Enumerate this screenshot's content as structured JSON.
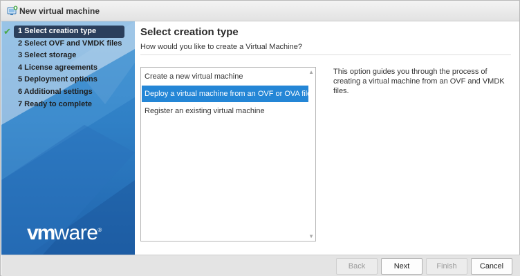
{
  "window": {
    "title": "New virtual machine",
    "icon": "new-vm-icon"
  },
  "sidebar": {
    "steps": [
      {
        "label": "1 Select creation type",
        "active": true,
        "completed": true
      },
      {
        "label": "2 Select OVF and VMDK files"
      },
      {
        "label": "3 Select storage"
      },
      {
        "label": "4 License agreements"
      },
      {
        "label": "5 Deployment options"
      },
      {
        "label": "6 Additional settings"
      },
      {
        "label": "7 Ready to complete"
      }
    ],
    "check_glyph": "✔",
    "logo": {
      "vm": "vm",
      "ware": "ware",
      "reg": "®"
    }
  },
  "main": {
    "title": "Select creation type",
    "subtitle": "How would you like to create a Virtual Machine?",
    "options": [
      {
        "label": "Create a new virtual machine"
      },
      {
        "label": "Deploy a virtual machine from an OVF or OVA file",
        "selected": true
      },
      {
        "label": "Register an existing virtual machine"
      }
    ],
    "description": "This option guides you through the process of creating a virtual machine from an OVF and VMDK files."
  },
  "footer": {
    "back_label": "Back",
    "next_label": "Next",
    "finish_label": "Finish",
    "cancel_label": "Cancel"
  },
  "colors": {
    "sidebar_blue": "#2f7fc5",
    "active_step_bg": "#2b3f5c",
    "selection_blue": "#2486d6",
    "check_green": "#4aa845"
  }
}
